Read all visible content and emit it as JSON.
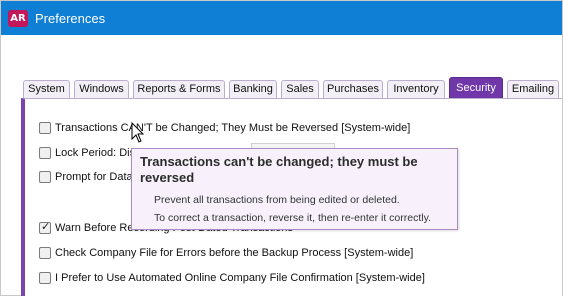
{
  "window": {
    "app_icon_text": "AR",
    "title": "Preferences"
  },
  "tabs": [
    {
      "label": "System",
      "active": false
    },
    {
      "label": "Windows",
      "active": false
    },
    {
      "label": "Reports & Forms",
      "active": false
    },
    {
      "label": "Banking",
      "active": false
    },
    {
      "label": "Sales",
      "active": false
    },
    {
      "label": "Purchases",
      "active": false
    },
    {
      "label": "Inventory",
      "active": false
    },
    {
      "label": "Security",
      "active": true
    },
    {
      "label": "Emailing",
      "active": false
    }
  ],
  "options": [
    {
      "label": "Transactions CAN'T be Changed; They Must be Reversed [System-wide]",
      "checked": false
    },
    {
      "label": "Lock Period: Disa",
      "checked": false
    },
    {
      "label": "Prompt for Data",
      "checked": false
    },
    {
      "label": "Warn Before Recording Post-Dated Transactions",
      "checked": true
    },
    {
      "label": "Check Company File for Errors before the Backup Process [System-wide]",
      "checked": false
    },
    {
      "label": "I Prefer to Use Automated Online Company File Confirmation [System-wide]",
      "checked": false
    }
  ],
  "tooltip": {
    "title": "Transactions can't be changed; they must be reversed",
    "line1": "Prevent all transactions from being edited or deleted.",
    "line2": "To correct a transaction, reverse it, then re-enter it correctly."
  },
  "colors": {
    "titlebar": "#0f7fd6",
    "active_tab": "#6f37a8",
    "app_icon": "#c2185b",
    "tooltip_bg": "#f8f1fc"
  }
}
